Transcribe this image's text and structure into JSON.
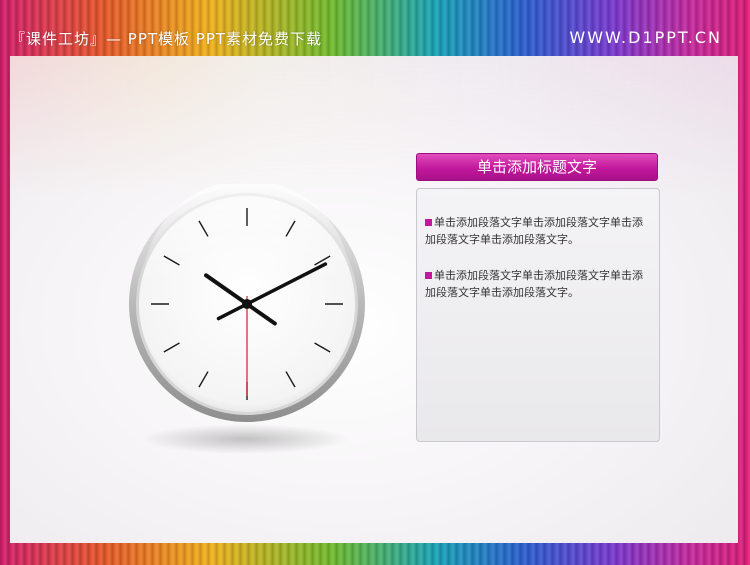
{
  "header": {
    "title": "『课件工坊』— PPT模板 PPT素材免费下载",
    "site": "WWW.D1PPT.CN"
  },
  "clock": {
    "hour": 10,
    "minute": 10,
    "second": 30
  },
  "content": {
    "heading": "单击添加标题文字",
    "paragraphs": [
      "单击添加段落文字单击添加段落文字单击添加段落文字单击添加段落文字。",
      "单击添加段落文字单击添加段落文字单击添加段落文字单击添加段落文字。"
    ]
  },
  "colors": {
    "accent": "#c2189c",
    "second_hand": "#d32f2f"
  }
}
